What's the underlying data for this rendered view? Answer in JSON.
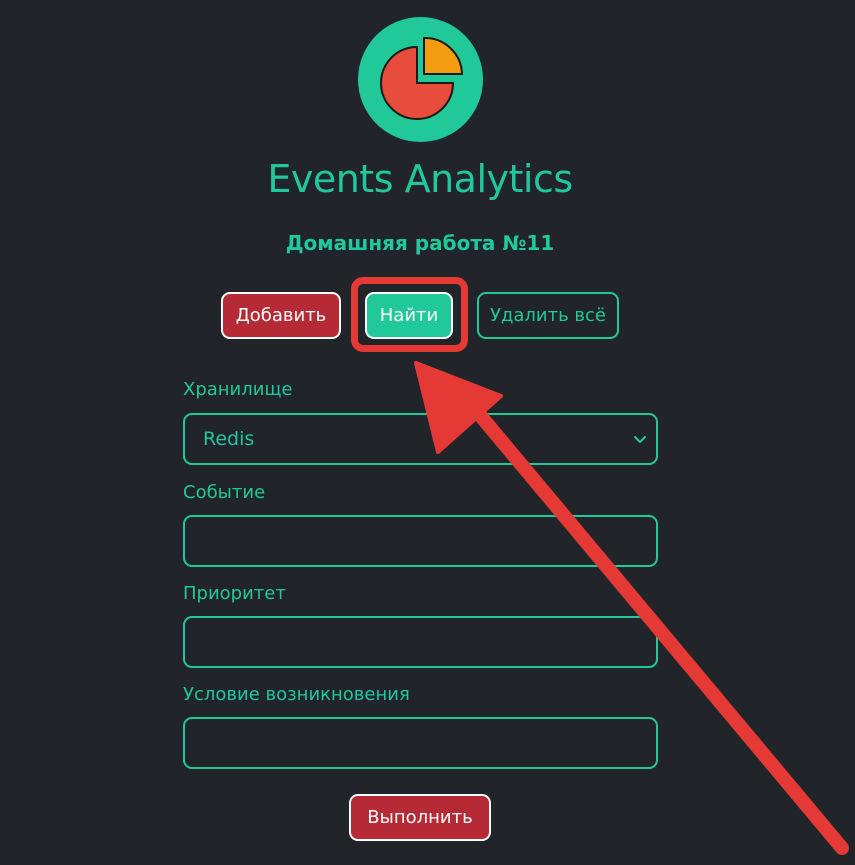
{
  "app": {
    "title": "Events Analytics",
    "subtitle": "Домашняя работа №11",
    "logo_icon": "pie-chart-icon"
  },
  "toolbar": {
    "add_label": "Добавить",
    "find_label": "Найти",
    "delete_all_label": "Удалить всё"
  },
  "form": {
    "storage": {
      "label": "Хранилище",
      "selected": "Redis"
    },
    "event": {
      "label": "Событие",
      "value": ""
    },
    "priority": {
      "label": "Приоритет",
      "value": ""
    },
    "condition": {
      "label": "Условие возникновения",
      "value": ""
    },
    "submit_label": "Выполнить"
  },
  "colors": {
    "background": "#212529",
    "accent": "#20c997",
    "danger": "#b52a35",
    "annotation": "#e53935",
    "pie_main": "#e74c3c",
    "pie_slice": "#f39c12"
  }
}
